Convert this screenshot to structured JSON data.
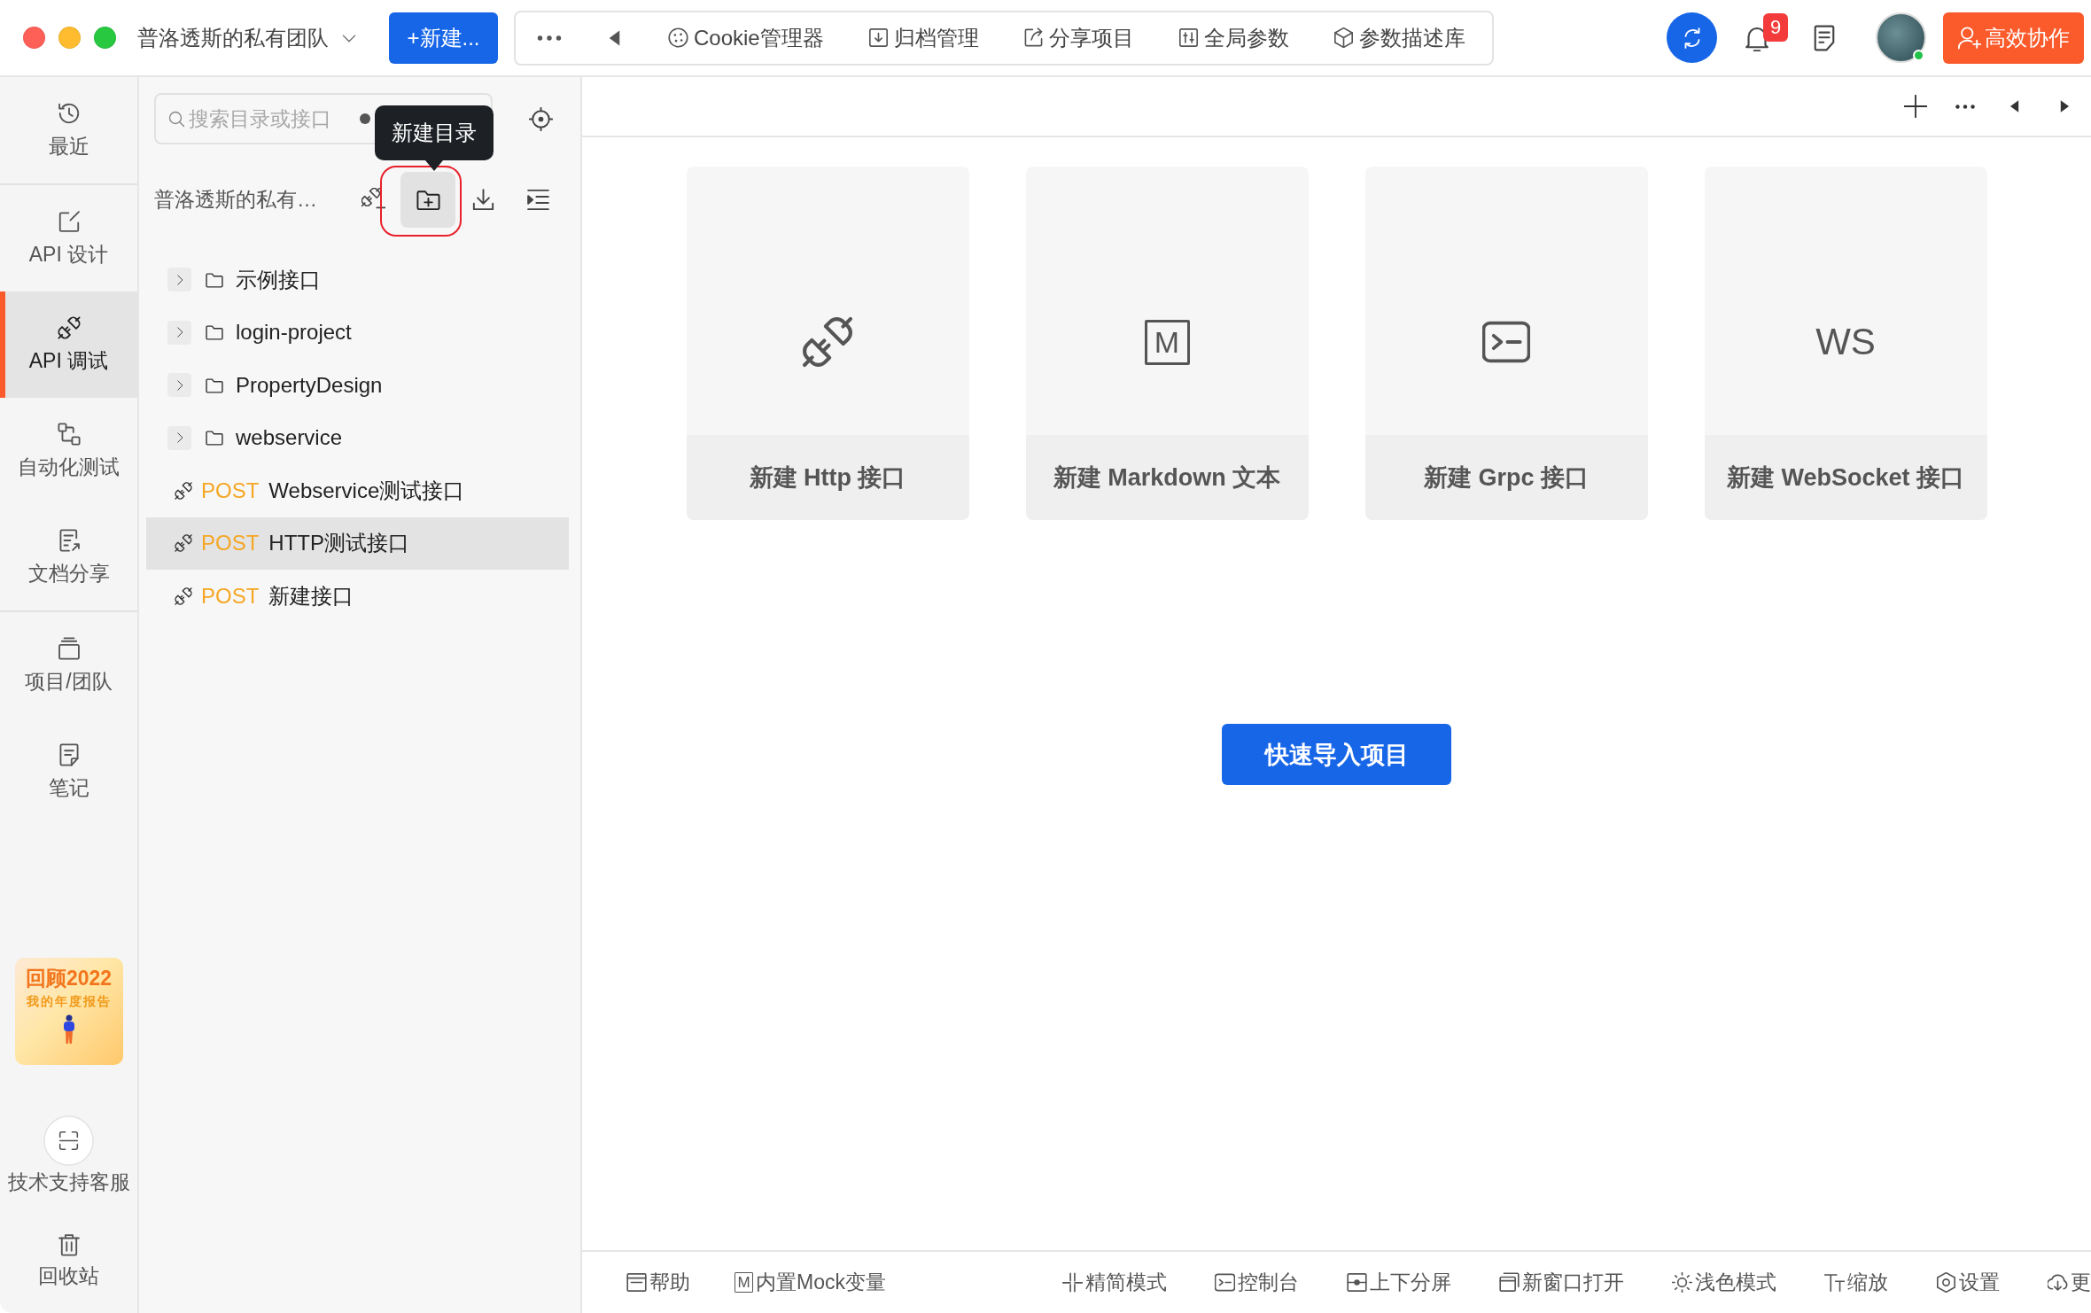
{
  "top_bar": {
    "team": "普洛透斯的私有团队",
    "new_button": "+新建...",
    "tools": [
      {
        "kind": "more"
      },
      {
        "kind": "back"
      },
      {
        "kind": "cookie",
        "label": "Cookie管理器"
      },
      {
        "kind": "archive",
        "label": "归档管理"
      },
      {
        "kind": "share",
        "label": "分享项目"
      },
      {
        "kind": "params",
        "label": "全局参数"
      },
      {
        "kind": "schema",
        "label": "参数描述库"
      }
    ],
    "notifications": "9",
    "avatar": {
      "online": true
    },
    "collab_button": "高效协作"
  },
  "nav": {
    "groups": [
      {
        "items": [
          {
            "kind": "recent",
            "label": "最近",
            "selected": false
          }
        ]
      },
      {
        "items": [
          {
            "kind": "design",
            "label": "API 设计",
            "selected": false
          },
          {
            "kind": "debug",
            "label": "API 调试",
            "selected": true
          },
          {
            "kind": "automation",
            "label": "自动化测试",
            "selected": false
          },
          {
            "kind": "docs",
            "label": "文档分享",
            "selected": false
          }
        ]
      },
      {
        "items": [
          {
            "kind": "projects",
            "label": "项目/团队",
            "selected": false
          },
          {
            "kind": "notes",
            "label": "笔记",
            "selected": false
          }
        ]
      }
    ],
    "promo": {
      "title": "回顾2022",
      "subtitle": "我的年度报告"
    },
    "bottom": [
      {
        "kind": "support",
        "label": "技术支持客服"
      },
      {
        "kind": "trash",
        "label": "回收站"
      }
    ]
  },
  "tree_panel": {
    "search": {
      "placeholder": "搜索目录或接口"
    },
    "project": {
      "name": "普洛透斯的私有…",
      "actions": [
        {
          "kind": "new-api",
          "hovered": false,
          "annotated": false
        },
        {
          "kind": "new-folder",
          "hovered": true,
          "annotated": true,
          "tooltip": "新建目录"
        },
        {
          "kind": "import",
          "hovered": false,
          "annotated": false
        },
        {
          "kind": "collapse",
          "hovered": false,
          "annotated": false
        }
      ]
    },
    "items": [
      {
        "kind": "folder",
        "name": "示例接口",
        "expanded": false,
        "selected": false
      },
      {
        "kind": "folder",
        "name": "login-project",
        "expanded": false,
        "selected": false
      },
      {
        "kind": "folder",
        "name": "PropertyDesign",
        "expanded": false,
        "selected": false
      },
      {
        "kind": "folder",
        "name": "webservice",
        "expanded": false,
        "selected": false
      },
      {
        "kind": "api",
        "method": "POST",
        "name": "Webservice测试接口",
        "selected": false
      },
      {
        "kind": "api",
        "method": "POST",
        "name": "HTTP测试接口",
        "selected": true
      },
      {
        "kind": "api",
        "method": "POST",
        "name": "新建接口",
        "selected": false
      }
    ]
  },
  "main": {
    "create_cards": [
      {
        "kind": "http",
        "label": "新建 Http 接口"
      },
      {
        "kind": "markdown",
        "glyph": "M",
        "label": "新建 Markdown 文本"
      },
      {
        "kind": "grpc",
        "label": "新建 Grpc 接口"
      },
      {
        "kind": "websocket",
        "glyph": "WS",
        "label": "新建 WebSocket 接口"
      }
    ],
    "import_button": "快速导入项目"
  },
  "status_bar": {
    "left": [
      {
        "kind": "help",
        "label": "帮助"
      },
      {
        "kind": "mock",
        "glyph": "M",
        "label": "内置Mock变量"
      }
    ],
    "right": [
      {
        "kind": "compact",
        "label": "精简模式"
      },
      {
        "kind": "console",
        "label": "控制台"
      },
      {
        "kind": "split",
        "label": "上下分屏"
      },
      {
        "kind": "new-window",
        "label": "新窗口打开"
      },
      {
        "kind": "theme",
        "label": "浅色模式"
      },
      {
        "kind": "zoom",
        "label": "缩放"
      },
      {
        "kind": "settings",
        "label": "设置"
      },
      {
        "kind": "more-download",
        "label": "更"
      }
    ]
  }
}
